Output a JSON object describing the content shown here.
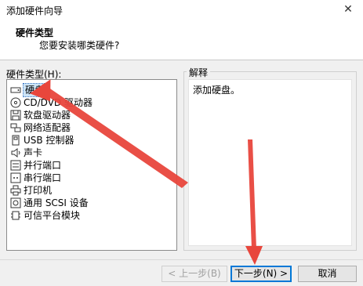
{
  "window": {
    "title": "添加硬件向导",
    "close_glyph": "✕"
  },
  "header": {
    "title": "硬件类型",
    "subtitle": "您要安装哪类硬件?"
  },
  "hardware_list": {
    "label": "硬件类型(H):",
    "items": [
      {
        "label": "硬盘",
        "icon": "hard-disk-icon",
        "selected": true
      },
      {
        "label": "CD/DVD 驱动器",
        "icon": "cd-dvd-icon"
      },
      {
        "label": "软盘驱动器",
        "icon": "floppy-icon"
      },
      {
        "label": "网络适配器",
        "icon": "network-adapter-icon"
      },
      {
        "label": "USB 控制器",
        "icon": "usb-icon"
      },
      {
        "label": "声卡",
        "icon": "sound-card-icon"
      },
      {
        "label": "并行端口",
        "icon": "parallel-port-icon"
      },
      {
        "label": "串行端口",
        "icon": "serial-port-icon"
      },
      {
        "label": "打印机",
        "icon": "printer-icon"
      },
      {
        "label": "通用 SCSI 设备",
        "icon": "scsi-icon"
      },
      {
        "label": "可信平台模块",
        "icon": "tpm-icon"
      }
    ]
  },
  "explanation": {
    "title": "解释",
    "text": "添加硬盘。"
  },
  "buttons": {
    "back": "< 上一步(B)",
    "next": "下一步(N) >",
    "cancel": "取消"
  },
  "colors": {
    "accent": "#0078d7",
    "annotation": "#e8463c",
    "selection": "#cce4f7"
  }
}
